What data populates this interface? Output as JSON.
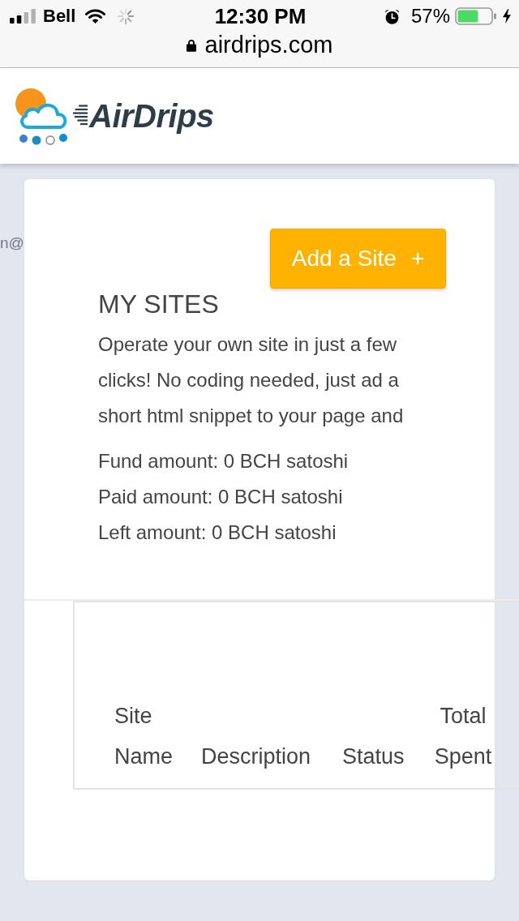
{
  "status_bar": {
    "carrier": "Bell",
    "time": "12:30 PM",
    "battery": "57%"
  },
  "address_bar": {
    "url": "airdrips.com"
  },
  "header": {
    "logo_text": "AirDrips"
  },
  "side_menu": {
    "text": "n@"
  },
  "my_sites": {
    "button": {
      "label": "Add a Site",
      "icon": "+"
    },
    "title": "MY SITES",
    "description": "Operate your own site in just a few clicks! No coding needed, just ad a short html snippet to your page and",
    "amounts": [
      "Fund amount: 0 BCH satoshi",
      "Paid amount: 0 BCH satoshi",
      "Left amount: 0 BCH satoshi"
    ]
  },
  "table": {
    "columns": [
      "Site Name",
      "Description",
      "Status",
      "Total Spent"
    ]
  }
}
